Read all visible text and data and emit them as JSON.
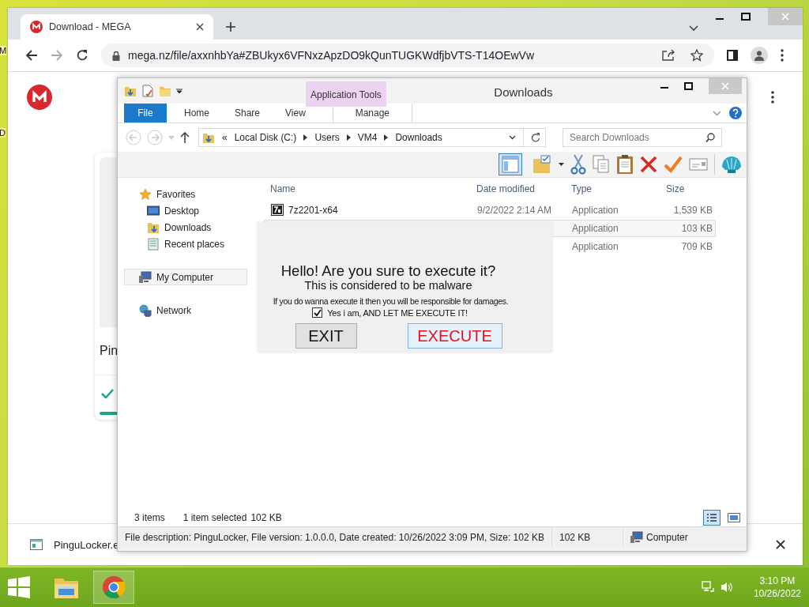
{
  "desktop": {
    "icon_labels": [
      "M",
      "D"
    ]
  },
  "browser": {
    "tab": {
      "title": "Download - MEGA"
    },
    "url": "mega.nz/file/axxnhbYa#ZBUkyx6VFNxzApzDO9kQunTUGKWdfjbVTS-T14OEwVw",
    "page": {
      "file_name": "Pin"
    },
    "download_bar": {
      "file": "PinguLocker.e"
    }
  },
  "explorer": {
    "title": "Downloads",
    "context_group": "Application Tools",
    "ribbon_tabs": [
      {
        "label": "File",
        "kind": "file"
      },
      {
        "label": "Home",
        "kind": "tab"
      },
      {
        "label": "Share",
        "kind": "tab"
      },
      {
        "label": "View",
        "kind": "tab"
      },
      {
        "label": "Manage",
        "kind": "context"
      }
    ],
    "address": {
      "overflow": "«",
      "crumbs": [
        "Local Disk (C:)",
        "Users",
        "VM4",
        "Downloads"
      ]
    },
    "search": {
      "placeholder": "Search Downloads"
    },
    "nav": [
      {
        "label": "Favorites",
        "selected": false,
        "children": [
          {
            "label": "Desktop"
          },
          {
            "label": "Downloads"
          },
          {
            "label": "Recent places"
          }
        ]
      },
      {
        "label": "My Computer",
        "selected": true
      },
      {
        "label": "Network",
        "selected": false
      }
    ],
    "columns": [
      "Name",
      "Date modified",
      "Type",
      "Size"
    ],
    "rows": [
      {
        "name": "7z2201-x64",
        "date": "9/2/2022 2:14 AM",
        "type": "Application",
        "size": "1,539 KB",
        "selected": false
      },
      {
        "type": "Application",
        "size": "103 KB",
        "selected": true
      },
      {
        "type": "Application",
        "size": "709 KB",
        "selected": false
      }
    ],
    "status": {
      "count": "3 items",
      "selection": "1 item selected",
      "selection_size": "102 KB"
    },
    "details": {
      "description": "File description: PinguLocker, File version: 1.0.0.0, Date created: 10/26/2022 3:09 PM, Size: 102 KB",
      "size": "102 KB",
      "location": "Computer"
    }
  },
  "dialog": {
    "heading": "Hello! Are you sure to execute it?",
    "subheading": "This is considered to be malware",
    "warning": "If you do wanna execute it then you will be responsible for damages.",
    "checkbox": {
      "label": "Yes i am, AND LET ME EXECUTE IT!",
      "checked": true
    },
    "buttons": [
      {
        "label": "EXIT",
        "kind": "exit"
      },
      {
        "label": "EXECUTE",
        "kind": "execute"
      }
    ]
  },
  "taskbar": {
    "apps": [
      {
        "kind": "explorer",
        "active": false
      },
      {
        "kind": "chrome",
        "active": true
      }
    ],
    "time": "3:10 PM",
    "date": "10/26/2022"
  }
}
